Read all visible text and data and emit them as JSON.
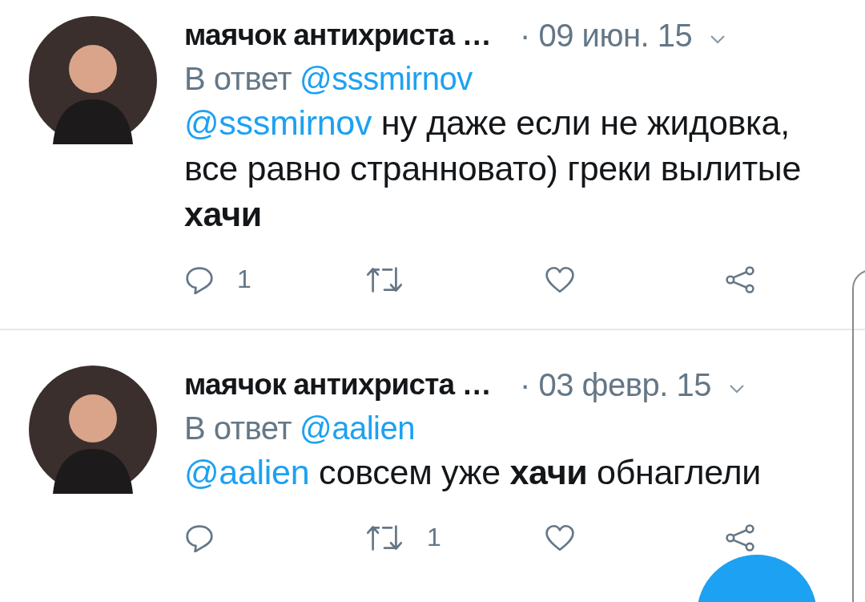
{
  "tweets": [
    {
      "name": "маячок антихриста …",
      "date": "· 09 июн. 15",
      "reply_label": "В ответ",
      "reply_to": "@sssmirnov",
      "mention": "@sssmirnov",
      "text": "ну даже если не жидовка, все равно странновато) греки вылитые **хачи**",
      "replies": "1"
    },
    {
      "name": "маячок антихриста …",
      "date": "· 03 февр. 15",
      "reply_label": "В ответ",
      "reply_to": "@aalien",
      "mention": "@aalien",
      "text": "совсем уже **хачи** обнаглели",
      "retweets": "1"
    }
  ]
}
